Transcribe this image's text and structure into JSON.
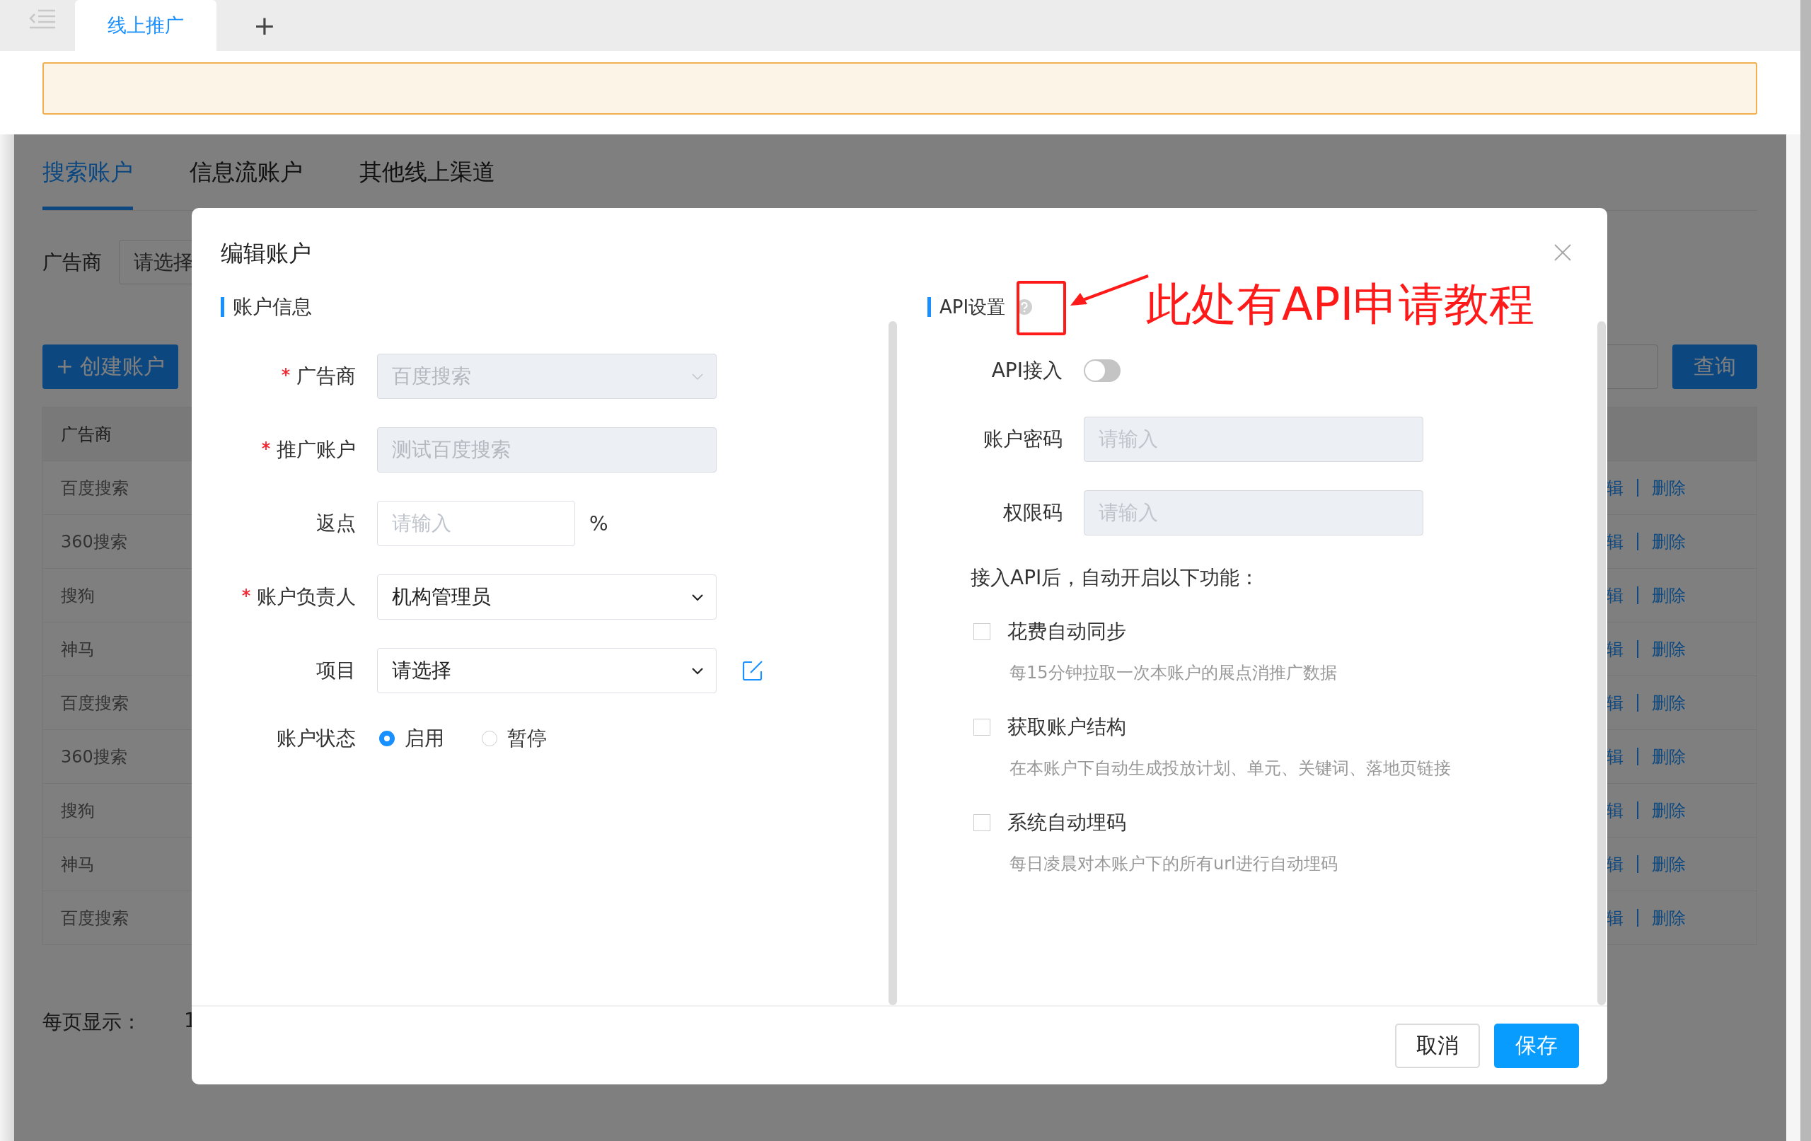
{
  "top_bar": {
    "tabs": [
      {
        "label": "线上推广",
        "selected": true
      }
    ],
    "new_tab": "+"
  },
  "page": {
    "tabs": [
      {
        "label": "搜索账户",
        "selected": true
      },
      {
        "label": "信息流账户",
        "selected": false
      },
      {
        "label": "其他线上渠道",
        "selected": false
      }
    ],
    "filter": {
      "label": "广告商",
      "placeholder": "请选择"
    },
    "create_button": "+ 创建账户",
    "query_button": "查询",
    "table": {
      "header": "广告商",
      "rows": [
        {
          "advertiser": "百度搜索",
          "edit": "辑",
          "separator": "|",
          "delete": "删除"
        },
        {
          "advertiser": "360搜索",
          "edit": "辑",
          "separator": "|",
          "delete": "删除"
        },
        {
          "advertiser": "搜狗",
          "edit": "辑",
          "separator": "|",
          "delete": "删除"
        },
        {
          "advertiser": "神马",
          "edit": "辑",
          "separator": "|",
          "delete": "删除"
        },
        {
          "advertiser": "百度搜索",
          "edit": "辑",
          "separator": "|",
          "delete": "删除"
        },
        {
          "advertiser": "360搜索",
          "edit": "辑",
          "separator": "|",
          "delete": "删除"
        },
        {
          "advertiser": "搜狗",
          "edit": "辑",
          "separator": "|",
          "delete": "删除"
        },
        {
          "advertiser": "神马",
          "edit": "辑",
          "separator": "|",
          "delete": "删除"
        },
        {
          "advertiser": "百度搜索",
          "edit": "辑",
          "separator": "|",
          "delete": "删除"
        }
      ]
    },
    "page_size": {
      "label": "每页显示：",
      "value": "1"
    }
  },
  "dialog": {
    "title": "编辑账户",
    "account_info": {
      "heading": "账户信息",
      "fields": [
        {
          "kind": "select",
          "label": "广告商",
          "required": true,
          "value": "百度搜索",
          "disabled": true,
          "edit_icon": false
        },
        {
          "kind": "input",
          "label": "推广账户",
          "required": true,
          "value": "测试百度搜索",
          "disabled": true,
          "edit_icon": false
        },
        {
          "kind": "input",
          "label": "返点",
          "required": false,
          "placeholder": "请输入",
          "unit": "%",
          "disabled": false,
          "edit_icon": false
        },
        {
          "kind": "select",
          "label": "账户负责人",
          "required": true,
          "value": "机构管理员",
          "disabled": false,
          "edit_icon": false
        },
        {
          "kind": "select",
          "label": "项目",
          "required": false,
          "value": "请选择",
          "disabled": false,
          "edit_icon": true
        },
        {
          "kind": "radio",
          "label": "账户状态",
          "required": false,
          "edit_icon": false,
          "options": [
            {
              "label": "启用",
              "selected": true
            },
            {
              "label": "暂停",
              "selected": false
            }
          ]
        }
      ]
    },
    "api_settings": {
      "heading": "API设置",
      "switch": {
        "label": "API接入",
        "on": false
      },
      "fields": [
        {
          "label": "账户密码",
          "placeholder": "请输入",
          "disabled": true
        },
        {
          "label": "权限码",
          "placeholder": "请输入",
          "disabled": true
        }
      ],
      "features_heading": "接入API后，自动开启以下功能：",
      "features": [
        {
          "label": "花费自动同步",
          "description": "每15分钟拉取一次本账户的展点消推广数据",
          "checked": false
        },
        {
          "label": "获取账户结构",
          "description": "在本账户下自动生成投放计划、单元、关键词、落地页链接",
          "checked": false
        },
        {
          "label": "系统自动埋码",
          "description": "每日凌晨对本账户下的所有url进行自动埋码",
          "checked": false
        }
      ]
    },
    "annotation": {
      "text": "此处有API申请教程"
    },
    "buttons": [
      {
        "label": "取消",
        "kind": "default"
      },
      {
        "label": "保存",
        "kind": "primary"
      }
    ]
  }
}
